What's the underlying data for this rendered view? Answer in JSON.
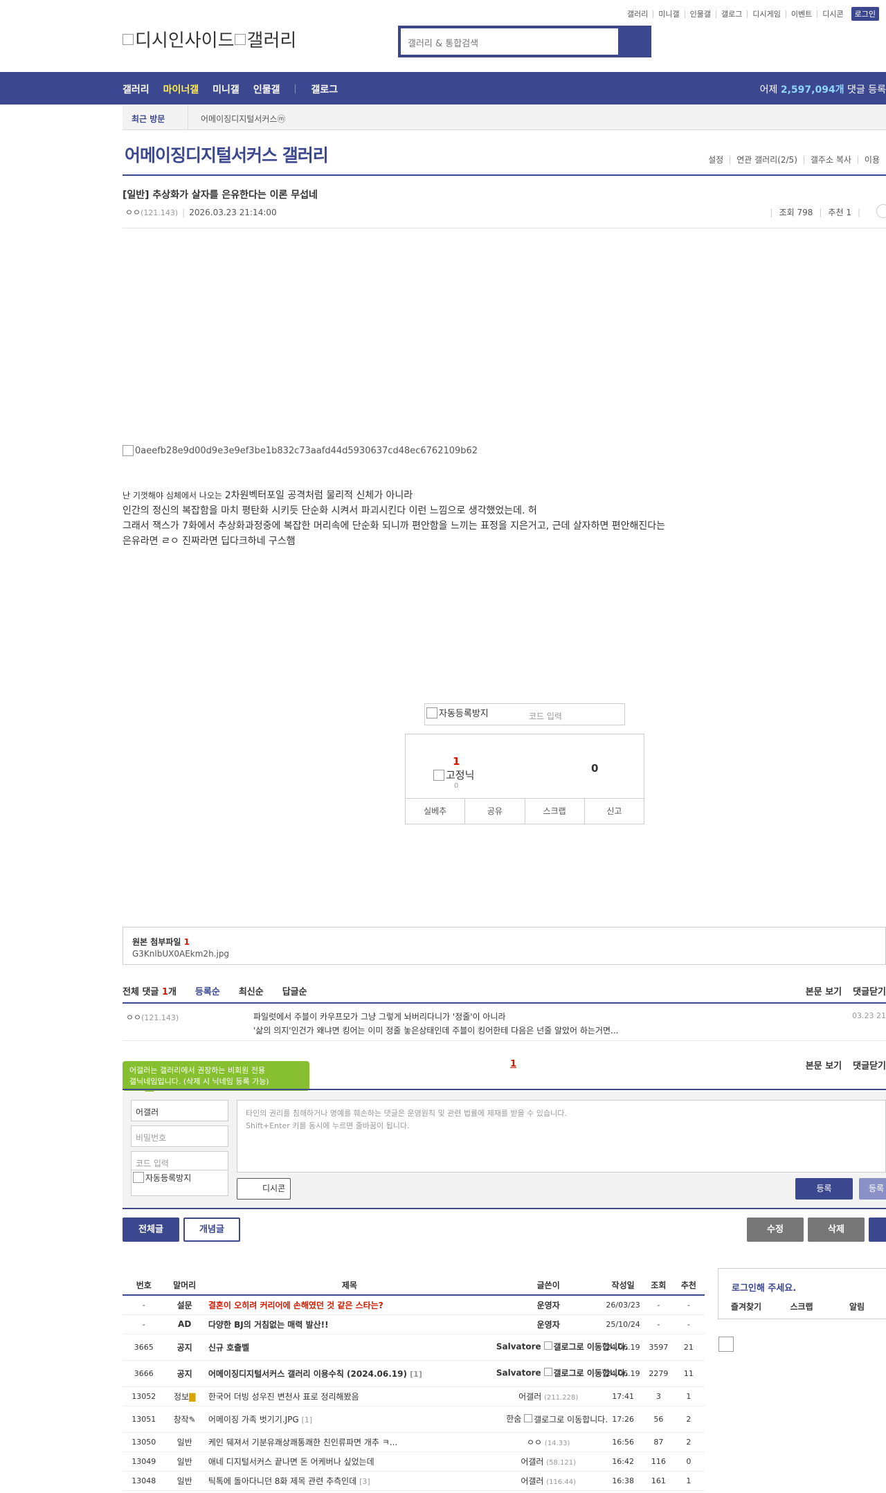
{
  "util_links": [
    "갤러리",
    "미니갤",
    "인물갤",
    "갤로그",
    "디시게임",
    "이벤트",
    "디시콘"
  ],
  "login_label": "로그인",
  "logo": {
    "alt1": "디시인사이드",
    "alt2": "갤러리"
  },
  "search": {
    "placeholder": "갤러리 & 통합검색"
  },
  "gnb": {
    "items": [
      "갤러리",
      "마이너갤",
      "미니갤",
      "인물갤",
      "갤로그"
    ],
    "stat_prefix": "어제 ",
    "stat_num": "2,597,094개",
    "stat_suffix": " 댓글 등록"
  },
  "recent": {
    "label": "최근 방문",
    "item": "어메이징디지털서커스ⓜ"
  },
  "gallery": {
    "title": "어메이징디지털서커스 갤러리",
    "options": [
      "설정",
      "연관 갤러리(2/5)",
      "갤주소 복사",
      "이용"
    ]
  },
  "post": {
    "title": "[일반] 추상화가 살자를 은유한다는 이론 무섭네",
    "writer": "ㅇㅇ",
    "ip": "(121.143)",
    "date": "2026.03.23 21:14:00",
    "views": "조회 798",
    "recommend": "추천 1",
    "image_alt": "0aeefb28e9d00d9e3e9ef3be1b832c73aafd44d5930637cd48ec6762109b62",
    "body": [
      {
        "small": "난 기껏해야 심체에서 나오는 ",
        "rest": "2차원벡터포일 공격처럼 물리적 신체가 아니라"
      },
      {
        "small": "",
        "rest": " 인간의 정신의 복잡함을 마치 평탄화 시키듯 단순화 시켜서 파괴시킨다 이런 느낌으로 생각했었는데. 허"
      },
      {
        "small": "",
        "rest": "그래서 잭스가 7화에서 추상화과정중에 복잡한 머리속에 단순화 되니까 편안함을 느끼는 표정을 지은거고, 근데 살자하면 편안해진다는"
      },
      {
        "small": "",
        "rest": "은유라면 ㄹㅇ 진짜라면 딥다크하네 구스햄"
      }
    ]
  },
  "captcha": {
    "alt": "자동등록방지",
    "placeholder": "코드 입력"
  },
  "vote": {
    "up": "1",
    "fixed_alt": "고정닉",
    "fixed_count": "0",
    "down": "0",
    "buttons": [
      "실베추",
      "공유",
      "스크랩",
      "신고"
    ]
  },
  "attach": {
    "label": "원본 첨부파일 ",
    "count": "1",
    "file": "G3KnlbUX0AEkm2h.jpg"
  },
  "comments": {
    "total_prefix": "전체 댓글 ",
    "total_num": "1",
    "total_suffix": "개",
    "sorts": [
      "등록순",
      "최신순",
      "답글순"
    ],
    "actions": [
      "본문 보기",
      "댓글닫기"
    ],
    "items": [
      {
        "writer": "ㅇㅇ",
        "ip": "(121.143)",
        "line1": "파일럿에서 주블이 카우프모가 그냥 그렇게 놔버리다니가 '정줄'이 아니라",
        "line2": "'삶의 의지'인건가 왜냐면 킹어는 이미 정줄 놓은상태인데 주블이 킹어한테 다음은 넌줄 알았어 하는거면...",
        "date": "03.23 21"
      }
    ],
    "page": "1"
  },
  "tooltip": {
    "line1": "어갤러는 갤러리에서 권장하는 비회원 전용",
    "line2": "갤닉네임입니다. (삭제 시 닉네임 등록 가능)"
  },
  "comment_form": {
    "nick": "어갤러",
    "password_ph": "비밀번호",
    "code_ph": "코드 입력",
    "captcha_alt": "자동등록방지",
    "textarea_line1": "타인의 권리를 침해하거나 명예를 훼손하는 댓글은 운영원칙 및 관련 법률에 제재를 받을 수 있습니다.",
    "textarea_line2": "Shift+Enter 키를 동시에 누르면 줄바꿈이 됩니다.",
    "dccon": "디시콘",
    "submit": "등록",
    "submit2": "등록"
  },
  "bottom_buttons": {
    "all": "전체글",
    "concept": "개념글",
    "edit": "수정",
    "delete": "삭제"
  },
  "list": {
    "headers": [
      "번호",
      "말머리",
      "제목",
      "글쓴이",
      "작성일",
      "조회",
      "추천"
    ],
    "rows": [
      {
        "type": "survey",
        "no": "-",
        "head": "설문",
        "title": "결혼이 오히려 커리어에 손해였던 것 같은 스타는?",
        "writer": "운영자",
        "ip": "",
        "date": "26/03/23",
        "views": "-",
        "rec": "-"
      },
      {
        "type": "ad",
        "no": "-",
        "head": "AD",
        "title": "다양한 BJ의 거침없는 매력 발산!!",
        "writer": "운영자",
        "ip": "",
        "date": "25/10/24",
        "views": "-",
        "rec": "-"
      },
      {
        "type": "notice",
        "no": "3665",
        "head": "공지",
        "title": "신규 호출벨",
        "writer": "Salvatore",
        "glog": "갤로그로 이동합니다.",
        "date": "24.06.19",
        "views": "3597",
        "rec": "21"
      },
      {
        "type": "notice",
        "no": "3666",
        "head": "공지",
        "title": "어메이징디지털서커스 갤러리 이용수칙 (2024.06.19)",
        "reply": "[1]",
        "writer": "Salvatore",
        "glog": "갤로그로 이동합니다.",
        "date": "24.06.19",
        "views": "2279",
        "rec": "11"
      },
      {
        "type": "normal",
        "no": "13052",
        "head": "정보",
        "title": "한국어 더빙 성우진 변천사 표로 정리해봤음",
        "writer": "어갤러",
        "ip": "(211.228)",
        "date": "17:41",
        "views": "3",
        "rec": "1"
      },
      {
        "type": "normal",
        "no": "13051",
        "head": "창작",
        "title": "어메이징 가족 벗기기.JPG",
        "reply": "[1]",
        "writer": "한숨",
        "glog": "갤로그로 이동합니다.",
        "date": "17:26",
        "views": "56",
        "rec": "2"
      },
      {
        "type": "normal",
        "no": "13050",
        "head": "일반",
        "title": "케인 뒈져서 기분유쾌상쾌통쾌한 친인류파면 개추 ㅋ...",
        "writer": "ㅇㅇ",
        "ip": "(14.33)",
        "date": "16:56",
        "views": "87",
        "rec": "2"
      },
      {
        "type": "normal",
        "no": "13049",
        "head": "일반",
        "title": "애네 디지털서커스 끝나면 돈 어케버나 싶었는데",
        "writer": "어갤러",
        "ip": "(58.121)",
        "date": "16:42",
        "views": "116",
        "rec": "0"
      },
      {
        "type": "normal",
        "no": "13048",
        "head": "일반",
        "title": "틱톡에 돌아다니던 8화 제목 관련 추측인데",
        "reply": "[3]",
        "writer": "어갤러",
        "ip": "(116.44)",
        "date": "16:38",
        "views": "161",
        "rec": "1"
      }
    ]
  },
  "loginbox": {
    "title": "로그인해 주세요.",
    "links": [
      "즐겨찾기",
      "스크랩",
      "알림"
    ]
  }
}
